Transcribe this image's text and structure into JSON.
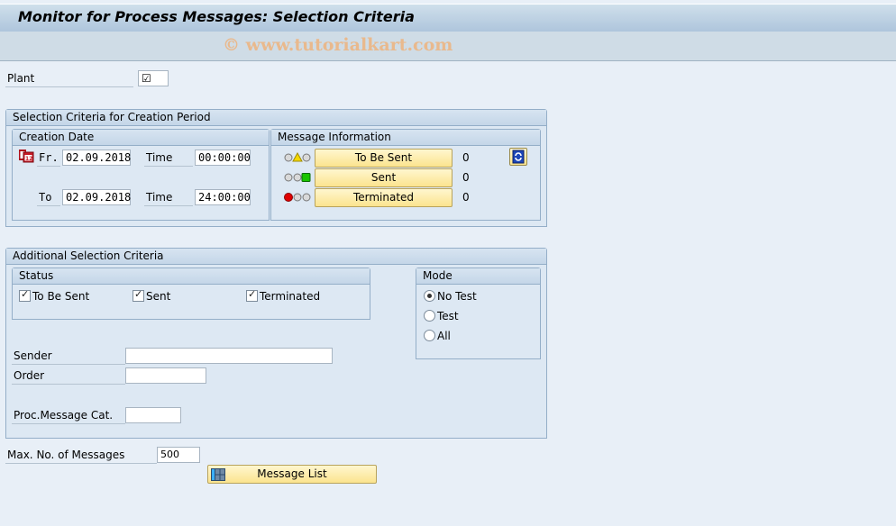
{
  "title": "Monitor for Process Messages: Selection Criteria",
  "watermark": "© www.tutorialkart.com",
  "plant": {
    "label": "Plant",
    "checked": true
  },
  "creation_period": {
    "title": "Selection Criteria for Creation Period",
    "creation_date": {
      "title": "Creation Date",
      "from_label": "Fr.",
      "from_date": "02.09.2018",
      "from_time_label": "Time",
      "from_time": "00:00:00",
      "to_label": "To",
      "to_date": "02.09.2018",
      "to_time_label": "Time",
      "to_time": "24:00:00"
    },
    "message_info": {
      "title": "Message Information",
      "rows": [
        {
          "status": "yellow",
          "label": "To Be Sent",
          "count": "0"
        },
        {
          "status": "green",
          "label": "Sent",
          "count": "0"
        },
        {
          "status": "red",
          "label": "Terminated",
          "count": "0"
        }
      ]
    }
  },
  "additional": {
    "title": "Additional Selection Criteria",
    "status": {
      "title": "Status",
      "items": [
        {
          "label": "To Be Sent",
          "checked": true
        },
        {
          "label": "Sent",
          "checked": true
        },
        {
          "label": "Terminated",
          "checked": true
        }
      ]
    },
    "mode": {
      "title": "Mode",
      "options": [
        {
          "label": "No Test",
          "selected": true
        },
        {
          "label": "Test",
          "selected": false
        },
        {
          "label": "All",
          "selected": false
        }
      ]
    },
    "sender": {
      "label": "Sender",
      "value": ""
    },
    "order": {
      "label": "Order",
      "value": ""
    },
    "proc_cat": {
      "label": "Proc.Message Cat.",
      "value": ""
    }
  },
  "max_messages": {
    "label": "Max. No. of Messages",
    "value": "500"
  },
  "message_list_button": "Message List",
  "colors": {
    "yellow": "#f5d800",
    "green": "#19c400",
    "red": "#e00000",
    "button": "#fbe48e"
  }
}
